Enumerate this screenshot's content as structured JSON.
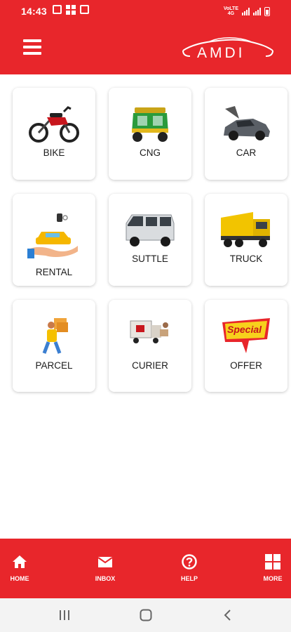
{
  "status_bar": {
    "time": "14:43",
    "network_top": "VoLTE",
    "network_bottom": "4G"
  },
  "header": {
    "logo_text": "AMDI"
  },
  "colors": {
    "brand_red": "#e8262b",
    "tile_bg": "#ffffff",
    "nav_text": "#ffffff"
  },
  "services": [
    {
      "label": "BIKE",
      "icon": "bike-icon"
    },
    {
      "label": "CNG",
      "icon": "cng-rickshaw-icon"
    },
    {
      "label": "CAR",
      "icon": "car-icon"
    },
    {
      "label": "RENTAL",
      "icon": "rental-icon"
    },
    {
      "label": "SUTTLE",
      "icon": "shuttle-van-icon"
    },
    {
      "label": "TRUCK",
      "icon": "truck-icon"
    },
    {
      "label": "PARCEL",
      "icon": "parcel-icon"
    },
    {
      "label": "CURIER",
      "icon": "courier-icon"
    },
    {
      "label": "OFFER",
      "icon": "offer-icon",
      "badge_text": "Special"
    }
  ],
  "bottom_nav": [
    {
      "label": "HOME",
      "icon": "home-icon"
    },
    {
      "label": "INBOX",
      "icon": "mail-icon"
    },
    {
      "label": "HELP",
      "icon": "help-icon"
    },
    {
      "label": "MORE",
      "icon": "grid-icon"
    }
  ],
  "system_nav": [
    "recents-icon",
    "home-circle-icon",
    "back-icon"
  ]
}
